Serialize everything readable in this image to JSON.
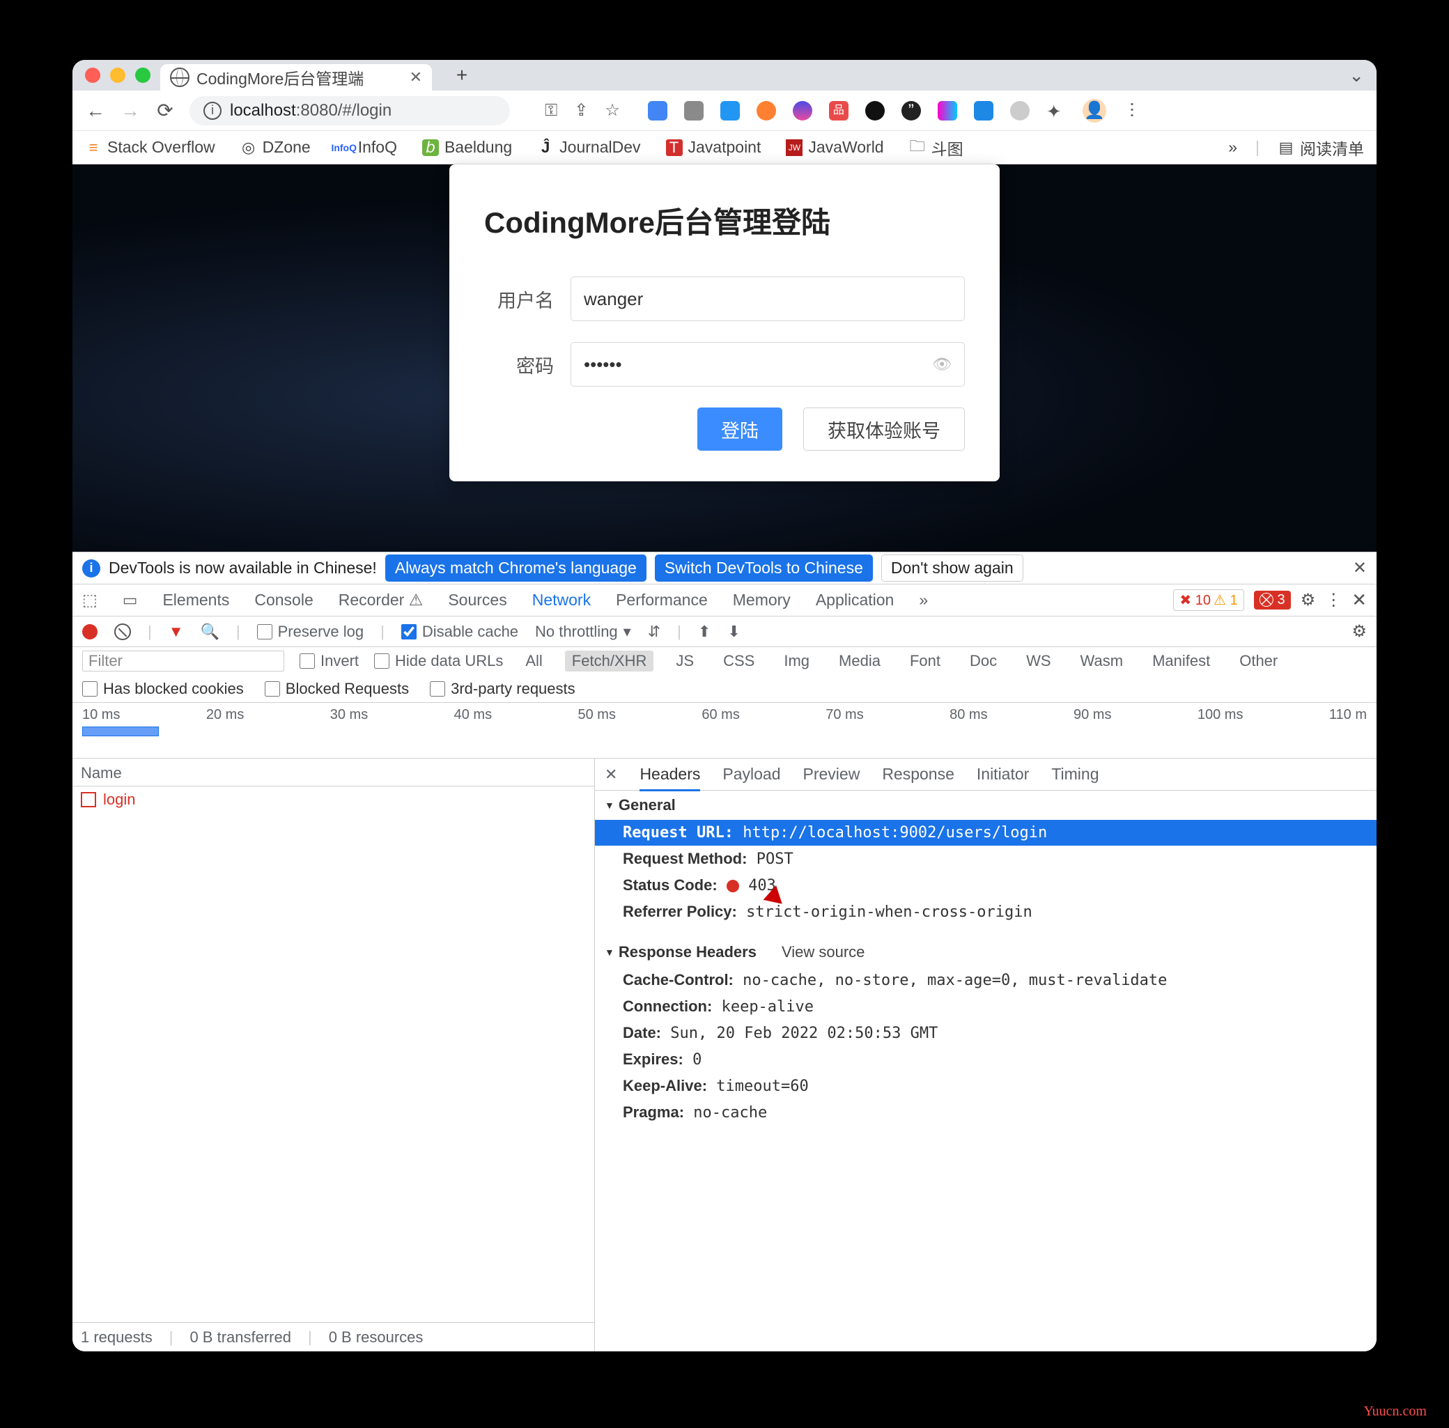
{
  "tab": {
    "title": "CodingMore后台管理端"
  },
  "address": {
    "protocol": "",
    "host": "localhost",
    "port": ":8080",
    "path": "/#/login"
  },
  "bookmarks": [
    {
      "icon": "📚",
      "label": "Stack Overflow"
    },
    {
      "icon": "◎",
      "label": "DZone"
    },
    {
      "icon": "InfoQ",
      "label": "InfoQ"
    },
    {
      "icon": "🍃",
      "label": "Baeldung"
    },
    {
      "icon": "Ĵ",
      "label": "JournalDev"
    },
    {
      "icon": "T",
      "label": "Javatpoint"
    },
    {
      "icon": "JW",
      "label": "JavaWorld"
    },
    {
      "icon": "🗀",
      "label": "斗图"
    }
  ],
  "bookmark_more": "»",
  "reading_list": "阅读清单",
  "login": {
    "title": "CodingMore后台管理登陆",
    "username_label": "用户名",
    "username_value": "wanger",
    "password_label": "密码",
    "password_value": "••••••",
    "login_btn": "登陆",
    "trial_btn": "获取体验账号"
  },
  "dt_banner": {
    "text": "DevTools is now available in Chinese!",
    "btn1": "Always match Chrome's language",
    "btn2": "Switch DevTools to Chinese",
    "btn3": "Don't show again"
  },
  "dt_tabs": [
    "Elements",
    "Console",
    "Recorder ⚠",
    "Sources",
    "Network",
    "Performance",
    "Memory",
    "Application",
    "»"
  ],
  "dt_badges": {
    "err": "✖ 10",
    "warn": "⚠ 1",
    "blk": "⛒ 3"
  },
  "toolbar": {
    "preserve": "Preserve log",
    "disable": "Disable cache",
    "throttle": "No throttling"
  },
  "filter": {
    "placeholder": "Filter",
    "invert": "Invert",
    "hide": "Hide data URLs",
    "types": [
      "All",
      "Fetch/XHR",
      "JS",
      "CSS",
      "Img",
      "Media",
      "Font",
      "Doc",
      "WS",
      "Wasm",
      "Manifest",
      "Other"
    ]
  },
  "filter2": {
    "blocked": "Has blocked cookies",
    "breq": "Blocked Requests",
    "third": "3rd-party requests"
  },
  "timeline": [
    "10 ms",
    "20 ms",
    "30 ms",
    "40 ms",
    "50 ms",
    "60 ms",
    "70 ms",
    "80 ms",
    "90 ms",
    "100 ms",
    "110 m"
  ],
  "req_list": {
    "header": "Name",
    "items": [
      "login"
    ]
  },
  "detail_tabs": [
    "Headers",
    "Payload",
    "Preview",
    "Response",
    "Initiator",
    "Timing"
  ],
  "headers": {
    "general_title": "General",
    "request_url_k": "Request URL:",
    "request_url_v": "http://localhost:9002/users/login",
    "method_k": "Request Method:",
    "method_v": "POST",
    "status_k": "Status Code:",
    "status_v": "403",
    "referrer_k": "Referrer Policy:",
    "referrer_v": "strict-origin-when-cross-origin",
    "response_title": "Response Headers",
    "view_source": "View source",
    "cc_k": "Cache-Control:",
    "cc_v": "no-cache, no-store, max-age=0, must-revalidate",
    "conn_k": "Connection:",
    "conn_v": "keep-alive",
    "date_k": "Date:",
    "date_v": "Sun, 20 Feb 2022 02:50:53 GMT",
    "exp_k": "Expires:",
    "exp_v": "0",
    "ka_k": "Keep-Alive:",
    "ka_v": "timeout=60",
    "pragma_k": "Pragma:",
    "pragma_v": "no-cache"
  },
  "status_bar": {
    "reqs": "1 requests",
    "xfer": "0 B transferred",
    "res": "0 B resources"
  },
  "watermark": "Yuucn.com"
}
